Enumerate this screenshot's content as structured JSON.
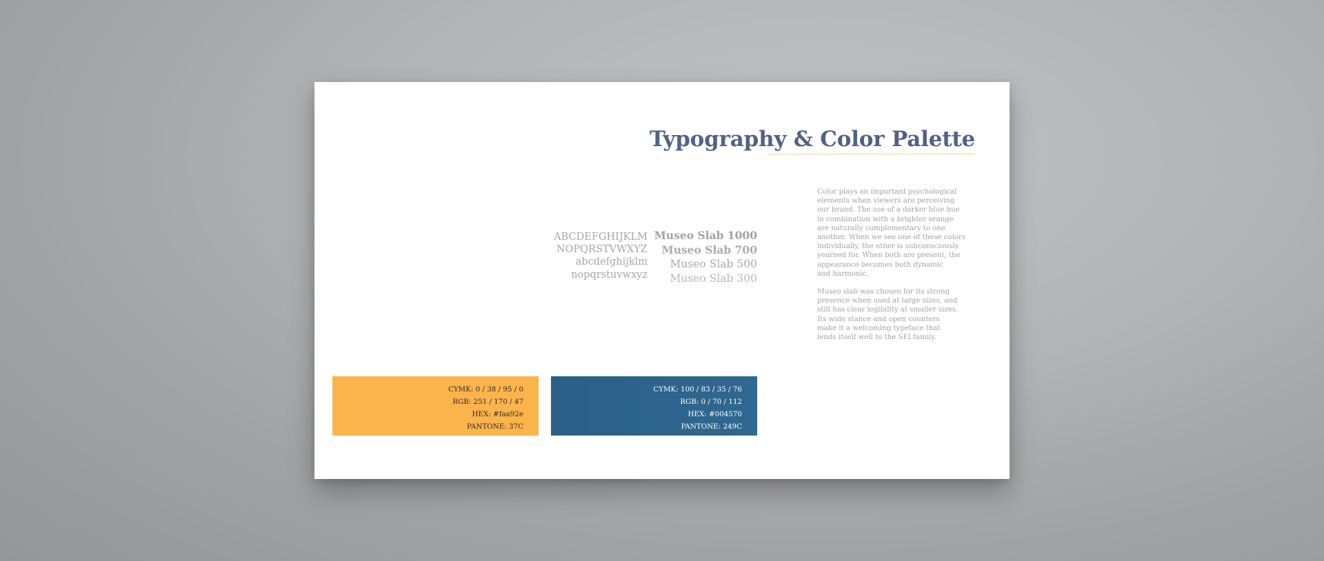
{
  "page": {
    "title": "Typography & Color Palette"
  },
  "typography": {
    "alphabet": [
      "ABCDEFGHIJKLM",
      "NOPQRSTVWXYZ",
      "abcdefghijklm",
      "nopqrstuvwxyz"
    ],
    "weights": [
      "Museo Slab 1000",
      "Museo Slab 700",
      "Museo Slab 500",
      "Museo Slab 300"
    ]
  },
  "body_copy": {
    "paragraph_1": "Color plays an important psychological\nelements when viewers are perceiving\nour brand. The use of a darker blue hue\nin combination with a brighter orange\nare naturally complementary to one\nanother.  When we see one of these colors\nindividually, the other is subconsciously\nyearned for. When both are present, the\nappearance becomes both dynamic\nand harmonic.",
    "paragraph_2": "Museo slab was chosen for its strong\npresence when used at large sizes, and\nstill has clear legibility at smaller sizes.\nIts wide stance and open counters\nmake it a welcoming typeface that\nlends itself well to the SEI family."
  },
  "swatches": [
    {
      "cymk": "CYMK: 0 / 38 / 95 / 0",
      "rgb": "RGB: 251 / 170 / 47",
      "hex": "HEX: #faa92e",
      "pantone": "PANTONE:  37C",
      "color": "#fbb44c"
    },
    {
      "cymk": "CYMK: 100 / 83 / 35 / 76",
      "rgb": "RGB: 0 / 70 / 112",
      "hex": "HEX: #004570",
      "pantone": "PANTONE: 249C",
      "color": "#2d6389"
    }
  ],
  "colors": {
    "background": "#b3b4b7",
    "card": "#ffffff",
    "title": "#526186",
    "title_rule": "#f6cf9a",
    "text_gray": "#a4a4a4"
  }
}
